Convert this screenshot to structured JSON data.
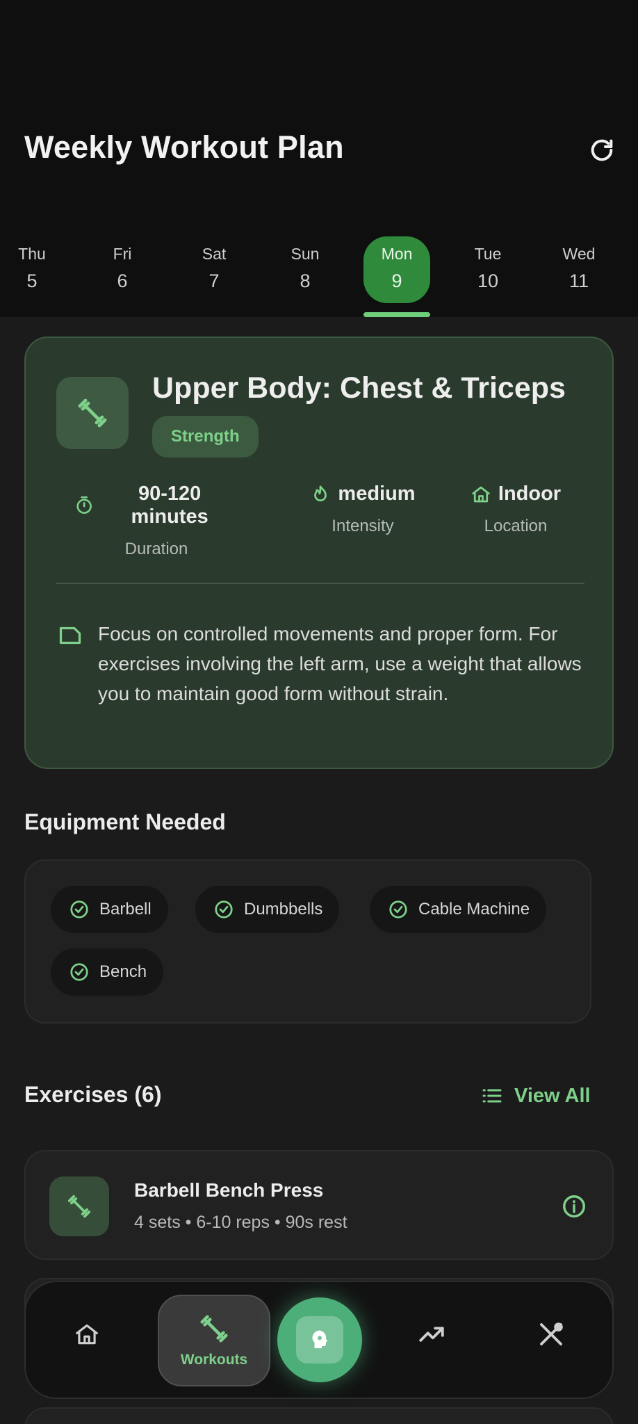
{
  "header": {
    "title": "Weekly Workout Plan",
    "refresh_icon": "refresh-icon"
  },
  "days": [
    {
      "name": "Thu",
      "num": "5"
    },
    {
      "name": "Fri",
      "num": "6"
    },
    {
      "name": "Sat",
      "num": "7"
    },
    {
      "name": "Sun",
      "num": "8"
    },
    {
      "name": "Mon",
      "num": "9",
      "active": true
    },
    {
      "name": "Tue",
      "num": "10"
    },
    {
      "name": "Wed",
      "num": "11"
    }
  ],
  "workout": {
    "title": "Upper Body: Chest & Triceps",
    "tag": "Strength",
    "icon": "dumbbell-icon",
    "stats": [
      {
        "value": "90-120 minutes",
        "label": "Duration",
        "icon": "timer-icon"
      },
      {
        "value": "medium",
        "label": "Intensity",
        "icon": "flame-icon"
      },
      {
        "value": "Indoor",
        "label": "Location",
        "icon": "home-icon"
      }
    ],
    "note": "Focus on controlled movements and proper form. For exercises involving the left arm, use a weight that allows you to maintain good form without strain."
  },
  "equipment": {
    "title": "Equipment Needed",
    "items": [
      "Barbell",
      "Dumbbells",
      "Cable Machine",
      "Bench"
    ]
  },
  "exercises": {
    "title": "Exercises (6)",
    "view_all": "View All",
    "items": [
      {
        "name": "Barbell Bench Press",
        "meta": "4 sets • 6-10 reps • 90s rest"
      }
    ]
  },
  "nav": {
    "items": [
      "home-icon",
      "dumbbell-icon",
      "brain-icon",
      "trending-up-icon",
      "utensils-icon"
    ],
    "active_label": "Workouts"
  },
  "colors": {
    "accent": "#7ed08a",
    "active_day": "#2f8a3b",
    "card_bg": "#2a3a2c",
    "fab": "#4caf7a"
  }
}
